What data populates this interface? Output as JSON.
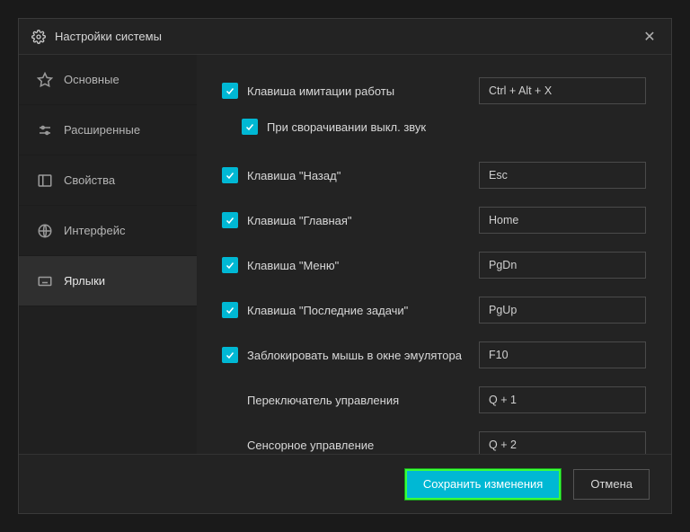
{
  "window": {
    "title": "Настройки системы"
  },
  "sidebar": {
    "items": [
      {
        "label": "Основные"
      },
      {
        "label": "Расширенные"
      },
      {
        "label": "Свойства"
      },
      {
        "label": "Интерфейс"
      },
      {
        "label": "Ярлыки"
      }
    ]
  },
  "settings": {
    "boss_key": {
      "label": "Клавиша имитации работы",
      "value": "Ctrl + Alt + X"
    },
    "mute_on_minimize": {
      "label": "При сворачивании выкл. звук"
    },
    "back_key": {
      "label": "Клавиша \"Назад\"",
      "value": "Esc"
    },
    "home_key": {
      "label": "Клавиша \"Главная\"",
      "value": "Home"
    },
    "menu_key": {
      "label": "Клавиша \"Меню\"",
      "value": "PgDn"
    },
    "recent_key": {
      "label": "Клавиша \"Последние задачи\"",
      "value": "PgUp"
    },
    "lock_mouse": {
      "label": "Заблокировать мышь в окне эмулятора",
      "value": "F10"
    },
    "control_switch": {
      "label": "Переключатель управления",
      "value": "Q + 1"
    },
    "touch_control": {
      "label": "Сенсорное управление",
      "value": "Q + 2"
    }
  },
  "footer": {
    "save": "Сохранить изменения",
    "cancel": "Отмена"
  }
}
